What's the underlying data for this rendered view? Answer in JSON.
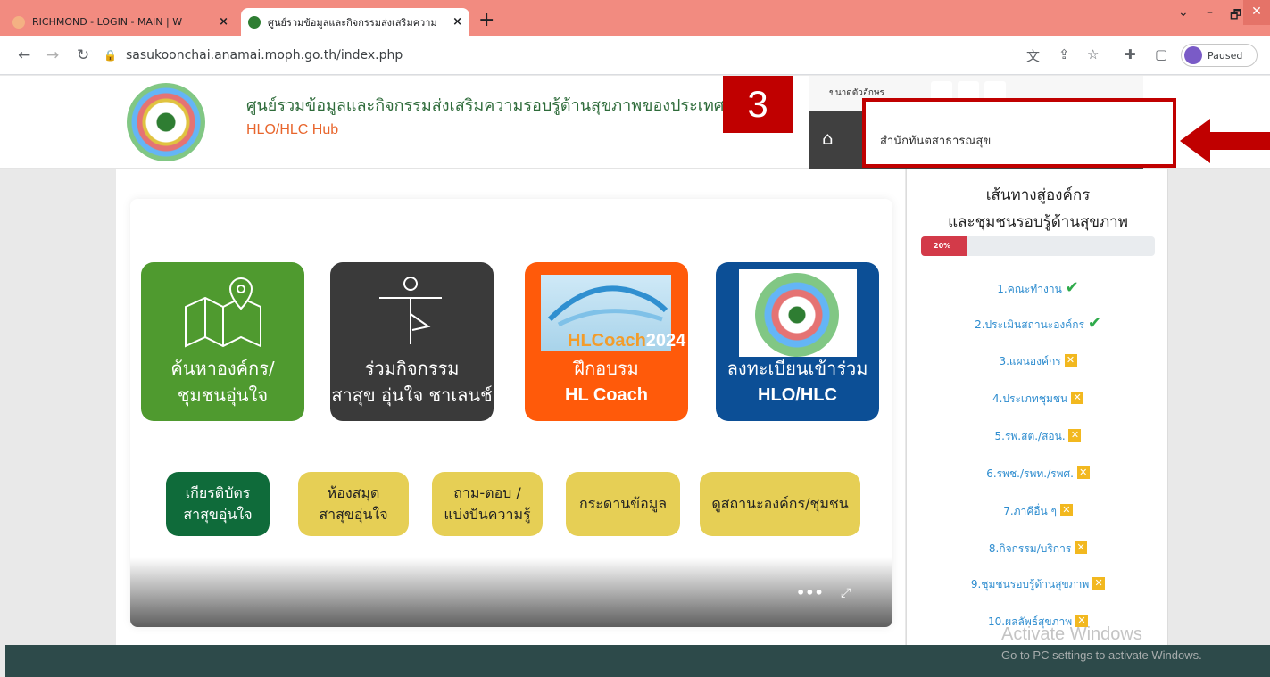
{
  "browser": {
    "tabs": [
      {
        "title": "RICHMOND - LOGIN - MAIN | W",
        "close": "×"
      },
      {
        "title": "ศูนย์รวมข้อมูลและกิจกรรมส่งเสริมความ",
        "close": "×"
      }
    ],
    "new_tab": "+",
    "url": "sasukoonchai.anamai.moph.go.th/index.php",
    "profile_label": "Paused",
    "window_controls": [
      "⌄",
      "–",
      "🗗",
      "✕"
    ]
  },
  "header": {
    "site_title": "ศูนย์รวมข้อมูลและกิจกรรมส่งเสริมความรอบรู้ด้านสุขภาพของประเทศไทย",
    "site_subtitle": "HLO/HLC Hub",
    "font_size_label": "ขนาดตัวอักษร",
    "dropdown_item": "สำนักทันตสาธารณสุข"
  },
  "annotation": {
    "step_number": "3",
    "accent": "#c00000"
  },
  "tiles": [
    {
      "line1": "ค้นหาองค์กร/",
      "line2": "ชุมชนอุ่นใจ",
      "color": "#4f9a2f"
    },
    {
      "line1": "ร่วมกิจกรรม",
      "line2": "สาสุข อุ่นใจ ชาเลนช์",
      "color": "#3a3a3a"
    },
    {
      "line1": "ฝึกอบรม",
      "line2": "HL Coach",
      "color": "#ff5a0a",
      "image_caption": "HLCoach",
      "image_year": "2024"
    },
    {
      "line1": "ลงทะเบียนเข้าร่วม",
      "line2": "HLO/HLC",
      "color": "#0c4f96"
    }
  ],
  "pills": [
    {
      "line1": "เกียรติบัตร",
      "line2": "สาสุขอุ่นใจ"
    },
    {
      "line1": "ห้องสมุด",
      "line2": "สาสุขอุ่นใจ"
    },
    {
      "line1": "ถาม-ตอบ /",
      "line2": "แบ่งปันความรู้"
    },
    {
      "line1": "กระดานข้อมูล",
      "line2": ""
    },
    {
      "line1": "ดูสถานะองค์กร/ชุมชน",
      "line2": ""
    }
  ],
  "sidebar": {
    "title_line1": "เส้นทางสู่องค์กร",
    "title_line2": "และชุมชนรอบรู้ด้านสุขภาพ",
    "progress_label": "20%",
    "progress_value": 20,
    "steps": [
      {
        "label": "1.คณะทำงาน",
        "done": true
      },
      {
        "label": "2.ประเมินสถานะองค์กร",
        "done": true
      },
      {
        "label": "3.แผนองค์กร",
        "done": false
      },
      {
        "label": "4.ประเภทชุมชน",
        "done": false
      },
      {
        "label": "5.รพ.สต./สอน.",
        "done": false
      },
      {
        "label": "6.รพช./รพท./รพศ.",
        "done": false
      },
      {
        "label": "7.ภาคีอื่น ๆ",
        "done": false
      },
      {
        "label": "8.กิจกรรม/บริการ",
        "done": false
      },
      {
        "label": "9.ชุมชนรอบรู้ด้านสุขภาพ",
        "done": false
      },
      {
        "label": "10.ผลลัพธ์สุขภาพ",
        "done": false
      }
    ]
  },
  "overlay": {
    "activate_title": "Activate Windows",
    "activate_sub": "Go to PC settings to activate Windows."
  }
}
